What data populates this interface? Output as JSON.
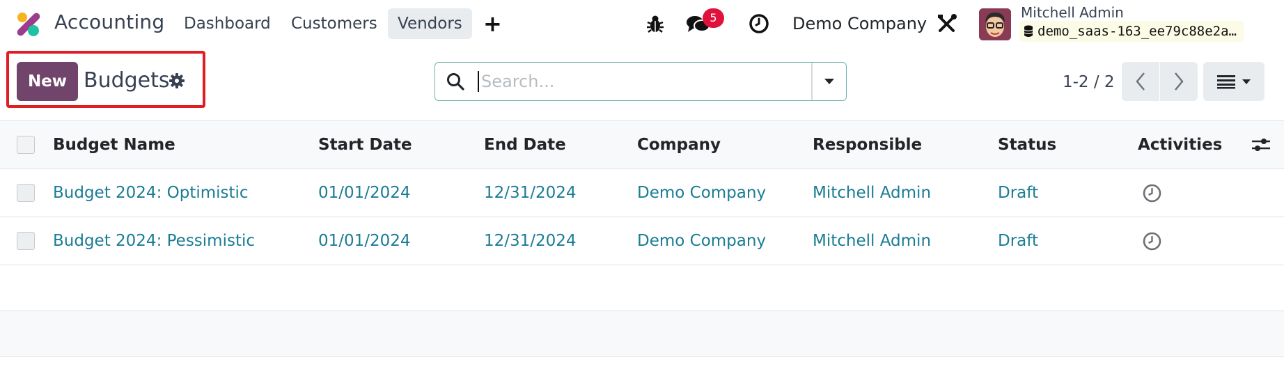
{
  "nav": {
    "app_name": "Accounting",
    "items": [
      {
        "label": "Dashboard",
        "active": false
      },
      {
        "label": "Customers",
        "active": false
      },
      {
        "label": "Vendors",
        "active": true
      }
    ],
    "plus_label": "+",
    "messages_badge": "5",
    "company": "Demo Company",
    "user_name": "Mitchell Admin",
    "database": "demo_saas-163_ee79c88e2a…"
  },
  "control_panel": {
    "new_label": "New",
    "title": "Budgets",
    "search_placeholder": "Search...",
    "pager": "1-2 / 2"
  },
  "table": {
    "columns": [
      "Budget Name",
      "Start Date",
      "End Date",
      "Company",
      "Responsible",
      "Status",
      "Activities"
    ],
    "rows": [
      {
        "name": "Budget 2024: Optimistic",
        "start": "01/01/2024",
        "end": "12/31/2024",
        "company": "Demo Company",
        "responsible": "Mitchell Admin",
        "status": "Draft"
      },
      {
        "name": "Budget 2024: Pessimistic",
        "start": "01/01/2024",
        "end": "12/31/2024",
        "company": "Demo Company",
        "responsible": "Mitchell Admin",
        "status": "Draft"
      }
    ]
  },
  "colors": {
    "accent": "#71456b",
    "link": "#1b7c94",
    "badge": "#e0123c",
    "highlight": "#e11d24"
  }
}
